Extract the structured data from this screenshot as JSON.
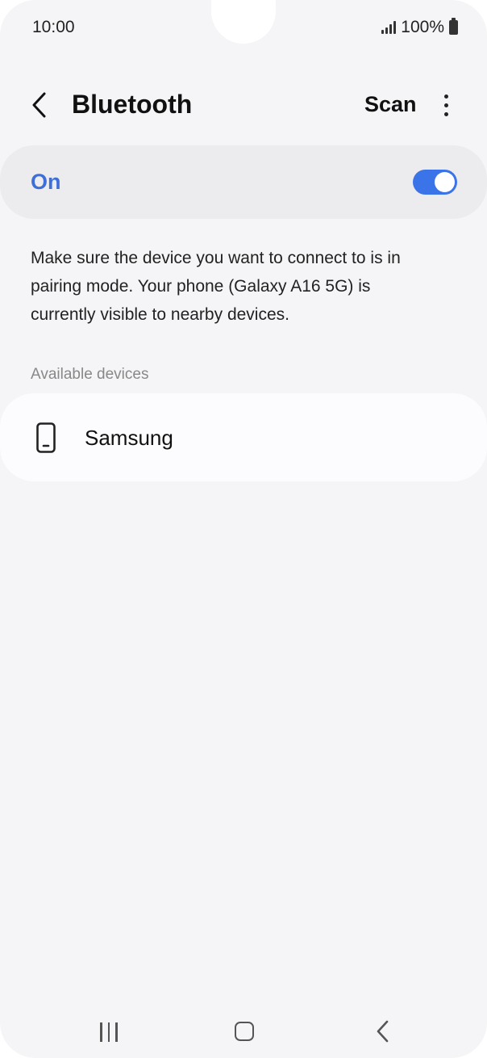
{
  "status_bar": {
    "time": "10:00",
    "battery": "100%",
    "signal_icon": "cellular-signal-icon",
    "battery_icon": "battery-icon"
  },
  "header": {
    "title": "Bluetooth",
    "scan_label": "Scan",
    "back_icon": "chevron-left-icon",
    "more_icon": "more-vert-icon"
  },
  "master_switch": {
    "label": "On",
    "state": true,
    "accent_color": "#3b74e8"
  },
  "description": "Make sure the device you want to connect to is in pairing mode. Your phone (Galaxy A16 5G) is currently visible to nearby devices.",
  "available_devices": {
    "header": "Available devices",
    "items": [
      {
        "name": "Samsung",
        "icon": "smartphone-icon"
      }
    ]
  },
  "nav_bar": {
    "recents_icon": "recent-apps-icon",
    "home_icon": "home-icon",
    "back_icon": "back-icon"
  }
}
